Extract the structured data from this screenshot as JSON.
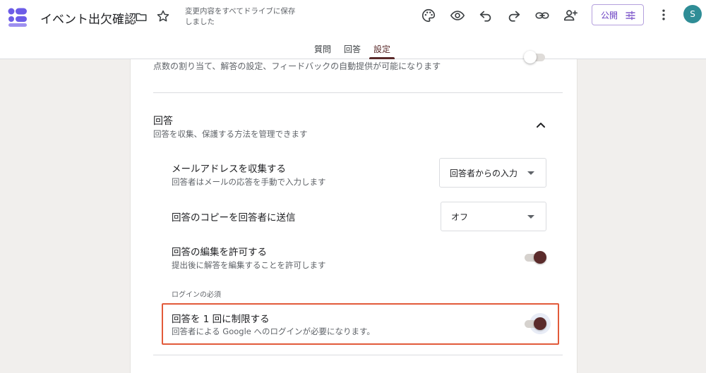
{
  "header": {
    "title": "イベント出欠確認",
    "save_status": "変更内容をすべてドライブに保存しました",
    "publish_label": "公開",
    "avatar_initial": "S",
    "colors": {
      "accent": "#6a3fc2",
      "brand": "#5a2a2a",
      "logo": "#6c5ce7",
      "avatar": "#2f8d96"
    }
  },
  "tabs": [
    {
      "label": "質問",
      "active": false
    },
    {
      "label": "回答",
      "active": false
    },
    {
      "label": "設定",
      "active": true
    }
  ],
  "settings": {
    "grading_desc": "点数の割り当て、解答の設定、フィードバックの自動提供が可能になります",
    "responses": {
      "title": "回答",
      "desc": "回答を収集、保護する方法を管理できます",
      "collect_email": {
        "title": "メールアドレスを収集する",
        "desc": "回答者はメールの応答を手動で入力します",
        "value": "回答者からの入力"
      },
      "send_copy": {
        "title": "回答のコピーを回答者に送信",
        "value": "オフ"
      },
      "allow_edit": {
        "title": "回答の編集を許可する",
        "desc": "提出後に解答を編集することを許可します",
        "on": true
      },
      "login_required_label": "ログインの必須",
      "limit_one": {
        "title": "回答を 1 回に制限する",
        "desc": "回答者による Google へのログインが必要になります。",
        "on": true
      }
    }
  }
}
